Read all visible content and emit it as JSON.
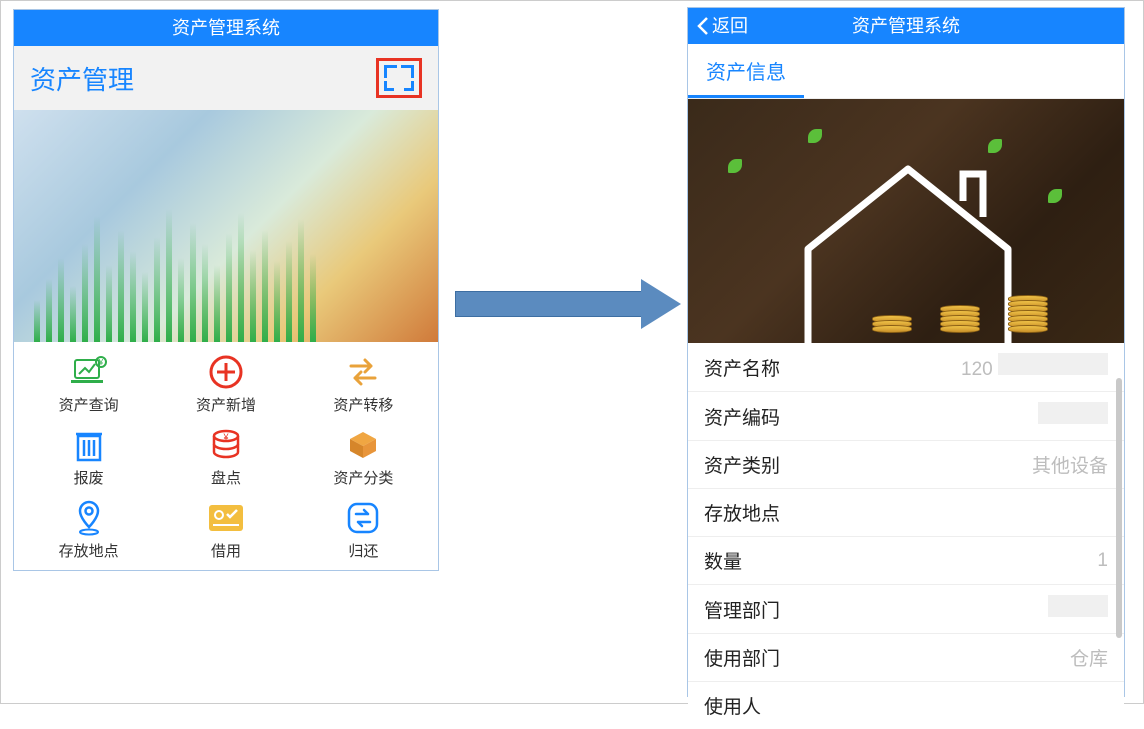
{
  "left": {
    "title": "资产管理系统",
    "section": "资产管理",
    "menu": [
      "资产查询",
      "资产新增",
      "资产转移",
      "报废",
      "盘点",
      "资产分类",
      "存放地点",
      "借用",
      "归还"
    ]
  },
  "right": {
    "back": "返回",
    "title": "资产管理系统",
    "tab": "资产信息",
    "fields": [
      {
        "k": "资产名称",
        "v": "120"
      },
      {
        "k": "资产编码",
        "v": ""
      },
      {
        "k": "资产类别",
        "v": "其他设备"
      },
      {
        "k": "存放地点",
        "v": ""
      },
      {
        "k": "数量",
        "v": "1"
      },
      {
        "k": "管理部门",
        "v": ""
      },
      {
        "k": "使用部门",
        "v": "仓库"
      },
      {
        "k": "使用人",
        "v": ""
      }
    ]
  }
}
